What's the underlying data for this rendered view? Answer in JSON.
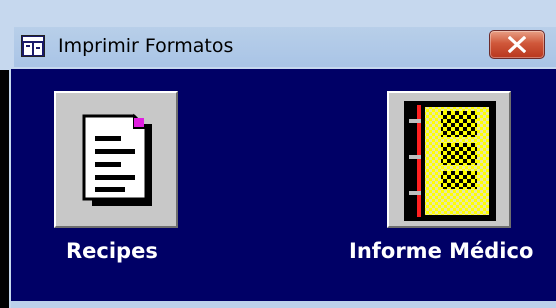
{
  "window": {
    "title": "Imprimir Formatos",
    "title_icon": "app-window-icon",
    "close_icon": "close-x-icon"
  },
  "buttons": [
    {
      "label": "Recipes",
      "icon": "document-page-icon"
    },
    {
      "label": "Informe Médico",
      "icon": "medical-report-book-icon"
    }
  ],
  "colors": {
    "client_background": "#000066",
    "titlebar": "#aec8e8",
    "close_button": "#c8462a",
    "button_face": "#c8c8c8",
    "label_text": "#ffffff"
  }
}
